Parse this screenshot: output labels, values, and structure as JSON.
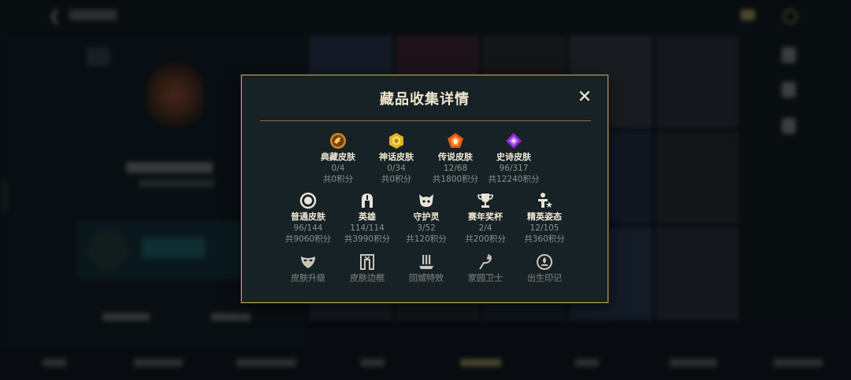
{
  "modal": {
    "title": "藏品收集详情",
    "close_label": "✕"
  },
  "rows": [
    [
      {
        "icon": "dragon-medal-icon",
        "label": "典藏皮肤",
        "count": "0/4",
        "points": "共0积分"
      },
      {
        "icon": "mythic-gem-icon",
        "label": "神话皮肤",
        "count": "0/34",
        "points": "共0积分"
      },
      {
        "icon": "legend-gem-icon",
        "label": "传说皮肤",
        "count": "12/68",
        "points": "共1800积分"
      },
      {
        "icon": "epic-gem-icon",
        "label": "史诗皮肤",
        "count": "96/317",
        "points": "共12240积分"
      }
    ],
    [
      {
        "icon": "ring-icon",
        "label": "普通皮肤",
        "count": "96/144",
        "points": "共9060积分"
      },
      {
        "icon": "helmet-icon",
        "label": "英雄",
        "count": "114/114",
        "points": "共3990积分"
      },
      {
        "icon": "spirit-icon",
        "label": "守护灵",
        "count": "3/52",
        "points": "共120积分"
      },
      {
        "icon": "trophy-icon",
        "label": "赛年奖杯",
        "count": "2/4",
        "points": "共200积分"
      },
      {
        "icon": "star-pose-icon",
        "label": "精英姿态",
        "count": "12/105",
        "points": "共360积分"
      }
    ],
    [
      {
        "icon": "mask-icon",
        "label": "皮肤升级"
      },
      {
        "icon": "frame-icon",
        "label": "皮肤边框"
      },
      {
        "icon": "city-effect-icon",
        "label": "回城特效"
      },
      {
        "icon": "guardian-icon",
        "label": "家园卫士"
      },
      {
        "icon": "birth-mark-icon",
        "label": "出生印记"
      }
    ]
  ],
  "colors": {
    "modal_bg": "#172226",
    "gold_border": "#b59a5b",
    "title_text": "#f0e6cf",
    "muted_text": "#8b908d"
  }
}
